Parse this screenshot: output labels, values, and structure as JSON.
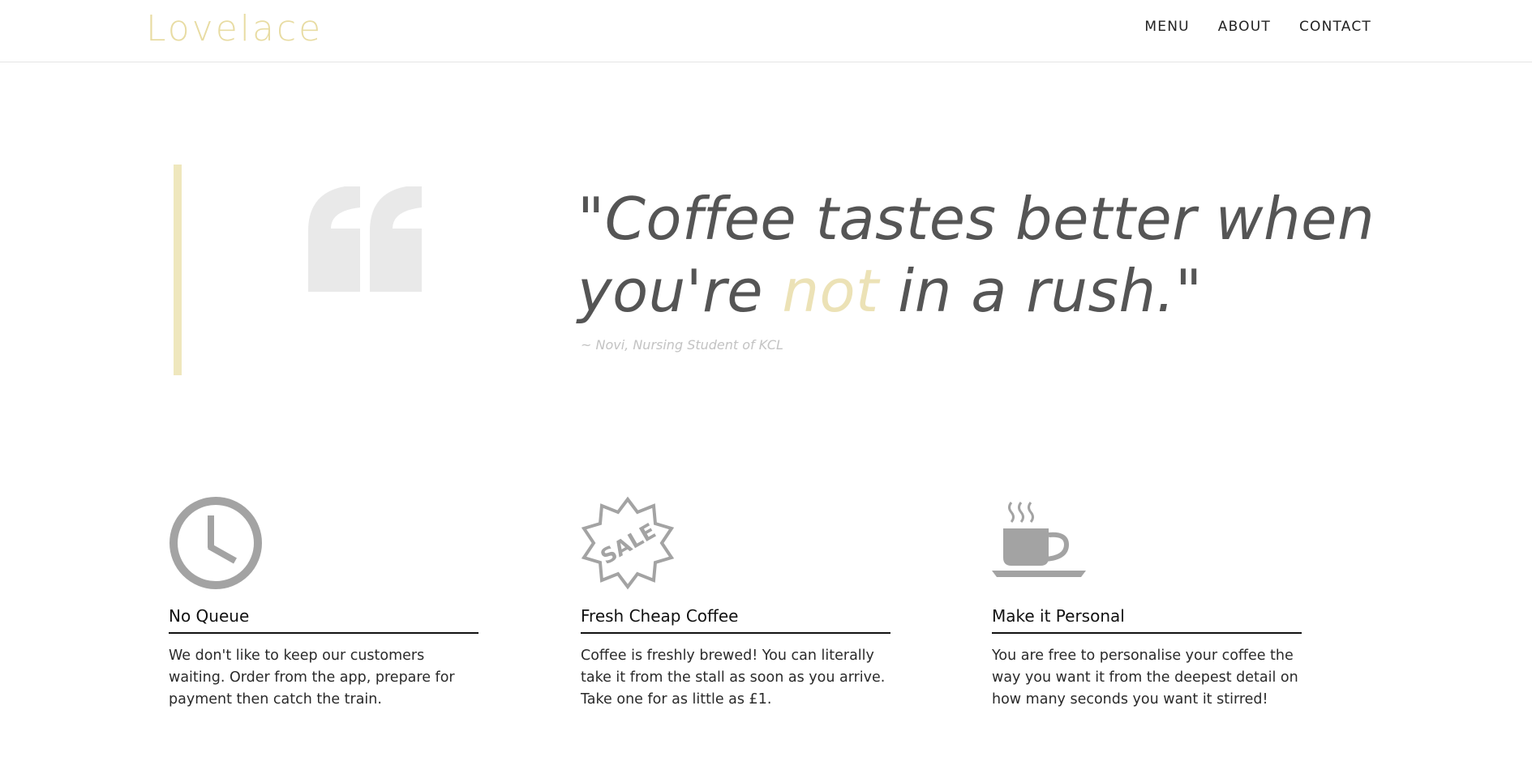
{
  "header": {
    "logo": "Lovelace",
    "nav": [
      "MENU",
      "ABOUT",
      "CONTACT"
    ]
  },
  "quote": {
    "line1": "\"Coffee tastes better when",
    "line2_before": "you're ",
    "line2_highlight": "not",
    "line2_after": " in a rush.\"",
    "author": "~ Novi, Nursing Student of KCL"
  },
  "features": [
    {
      "icon": "clock-icon",
      "title": "No Queue",
      "description": "We don't like to keep our customers waiting. Order from the app, prepare for payment then catch the train."
    },
    {
      "icon": "sale-badge-icon",
      "title": "Fresh Cheap Coffee",
      "description": "Coffee is freshly brewed! You can literally take it from the stall as soon as you arrive. Take one for as little as £1."
    },
    {
      "icon": "coffee-cup-icon",
      "title": "Make it Personal",
      "description": "You are free to personalise your coffee the way you want it from the deepest detail on how many seconds you want it stirred!"
    }
  ],
  "icon_badge_text": "SALE",
  "colors": {
    "accent": "#e8dca3",
    "quote_bar": "#efe7bd",
    "quote_text": "#555555",
    "icon_gray": "#a3a3a3"
  }
}
